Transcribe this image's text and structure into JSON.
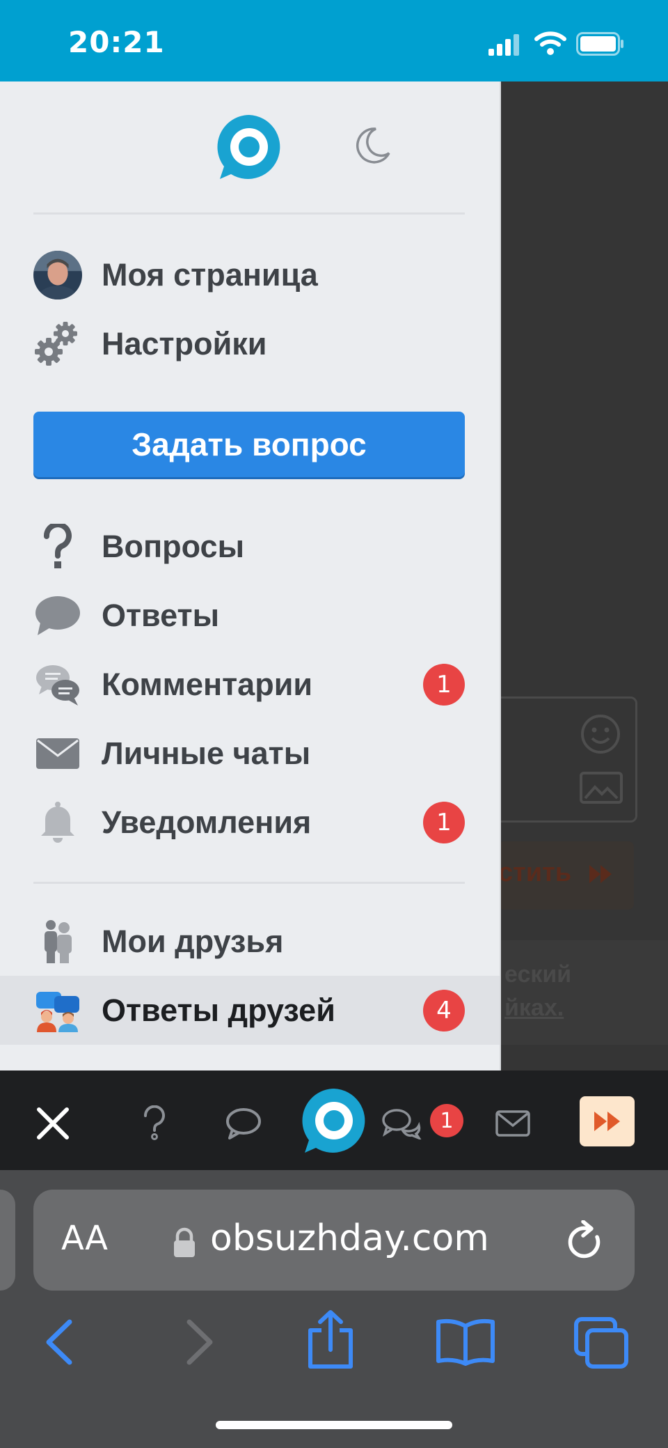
{
  "status_bar": {
    "time": "20:21"
  },
  "drawer": {
    "profile_items": [
      {
        "label": "Моя страница",
        "icon": "avatar"
      },
      {
        "label": "Настройки",
        "icon": "gears-icon"
      }
    ],
    "ask_button_label": "Задать вопрос",
    "menu_items": [
      {
        "label": "Вопросы",
        "icon": "question-icon",
        "badge": null
      },
      {
        "label": "Ответы",
        "icon": "speech-bubble-icon",
        "badge": null
      },
      {
        "label": "Комментарии",
        "icon": "comments-icon",
        "badge": "1"
      },
      {
        "label": "Личные чаты",
        "icon": "envelope-icon",
        "badge": null
      },
      {
        "label": "Уведомления",
        "icon": "bell-icon",
        "badge": "1"
      }
    ],
    "friends_items": [
      {
        "label": "Мои друзья",
        "icon": "friends-icon",
        "badge": null
      },
      {
        "label": "Ответы друзей",
        "icon": "friends-answers-icon",
        "badge": "4",
        "active": true
      }
    ]
  },
  "behind_page": {
    "text_line_1": "еский",
    "text_line_2": "йках.",
    "button_label": "стить"
  },
  "toolbar": {
    "comments_badge": "1"
  },
  "safari": {
    "aa_label": "AA",
    "url": "obsuzhday.com"
  },
  "colors": {
    "brand": "#00a0d0",
    "ask_button": "#2a87e4",
    "badge": "#e84444",
    "safari_blue": "#3d8af7"
  }
}
